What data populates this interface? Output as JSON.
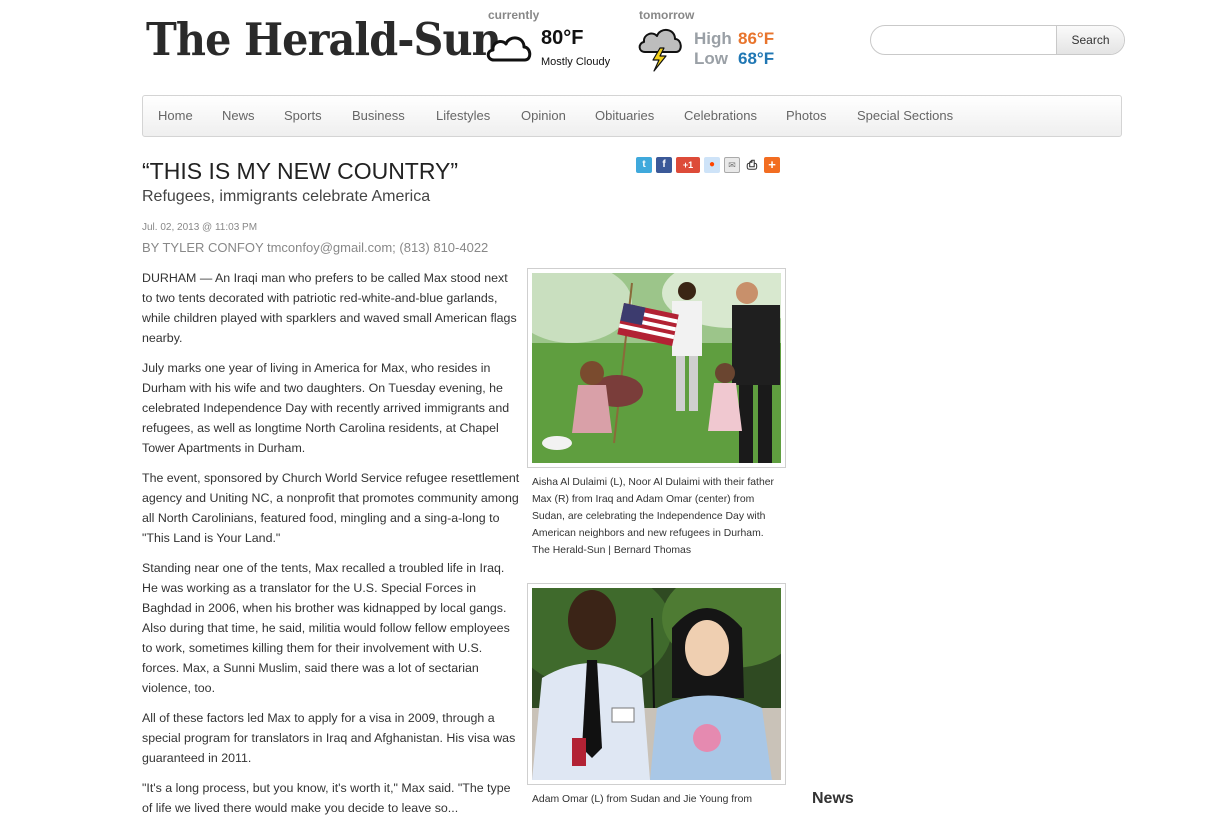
{
  "header": {
    "logo_text": "The Herald-Sun"
  },
  "weather": {
    "current_label": "currently",
    "current_icon": "cloud-icon",
    "current_temp": "80°F",
    "current_condition": "Mostly Cloudy",
    "tomorrow_label": "tomorrow",
    "tomorrow_icon": "thunderstorm-icon",
    "high_label": "High",
    "high_temp": "86°F",
    "low_label": "Low",
    "low_temp": "68°F",
    "high_color": "#e8742c",
    "low_color": "#1f77b4"
  },
  "search": {
    "placeholder": "",
    "value": "",
    "button_label": "Search"
  },
  "nav": {
    "items": [
      {
        "label": "Home"
      },
      {
        "label": "News"
      },
      {
        "label": "Sports"
      },
      {
        "label": "Business"
      },
      {
        "label": "Lifestyles"
      },
      {
        "label": "Opinion"
      },
      {
        "label": "Obituaries"
      },
      {
        "label": "Celebrations"
      },
      {
        "label": "Photos"
      },
      {
        "label": "Special Sections"
      }
    ]
  },
  "share": {
    "icons": [
      "twitter-icon",
      "facebook-icon",
      "google-plus-icon",
      "reddit-icon",
      "email-icon",
      "print-icon",
      "more-share-icon"
    ],
    "gplus_text": "+1"
  },
  "article": {
    "headline": "“THIS IS MY NEW COUNTRY”",
    "subhead": "Refugees, immigrants celebrate America",
    "date": "Jul. 02, 2013 @ 11:03 PM",
    "byline": "BY TYLER CONFOY tmconfoy@gmail.com; (813) 810-4022",
    "paragraphs": [
      "DURHAM — An Iraqi man who prefers to be called Max stood next to two tents decorated with patriotic red-white-and-blue garlands, while children played with sparklers and waved small American flags nearby.",
      "July marks one year of living in America for Max, who resides in Durham with his wife and two daughters. On Tuesday evening, he celebrated Independence Day with recently arrived immigrants and refugees, as well as longtime North Carolina residents, at Chapel Tower Apartments in Durham.",
      "The event, sponsored by Church World Service refugee resettlement agency and Uniting NC, a nonprofit that promotes community among all North Carolinians, featured food, mingling and a sing-a-long to \"This Land is Your Land.\"",
      "Standing near one of the tents, Max recalled a troubled life in Iraq. He was working as a translator for the U.S. Special Forces in Baghdad in 2006, when his brother was kidnapped by local gangs. Also during that time, he said, militia would follow fellow employees to work, sometimes killing them for their involvement with U.S. forces. Max, a Sunni Muslim, said there was a lot of sectarian violence, too.",
      "All of these factors led Max to apply for a visa in 2009, through a special program for translators in Iraq and Afghanistan. His visa was guaranteed in 2011.",
      "\"It's a long process, but you know, it's worth it,\" Max said. \"The type of life we lived there would make you decide to leave so..."
    ],
    "photo1_caption": "Aisha Al Dulaimi (L), Noor Al Dulaimi with their father Max (R) from Iraq and Adam Omar (center) from Sudan, are celebrating the Independence Day with American neighbors and new refugees in Durham. The Herald-Sun | Bernard Thomas",
    "photo2_caption": "Adam Omar (L) from Sudan and Jie Young from"
  },
  "sidebar": {
    "heading": "News"
  }
}
